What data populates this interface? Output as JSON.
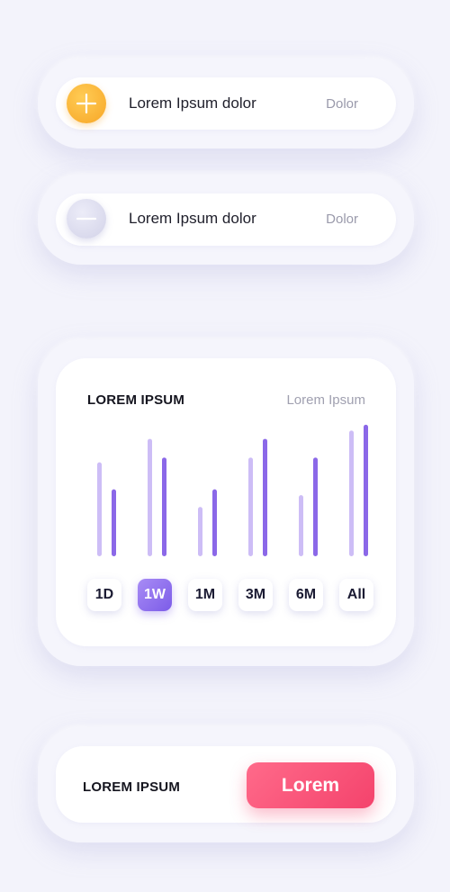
{
  "rows": [
    {
      "icon": "plus-icon",
      "label": "Lorem Ipsum dolor",
      "value": "Dolor",
      "icon_color": "#f7a626"
    },
    {
      "icon": "minus-icon",
      "label": "Lorem Ipsum dolor",
      "value": "Dolor",
      "icon_color": "#d2d2e8"
    }
  ],
  "chart_card": {
    "title": "LOREM IPSUM",
    "subtitle": "Lorem Ipsum",
    "tabs": [
      "1D",
      "1W",
      "1M",
      "3M",
      "6M",
      "All"
    ],
    "active_tab": "1W"
  },
  "chart_data": {
    "type": "bar",
    "categories": [
      "1D",
      "1W",
      "1M",
      "3M",
      "6M",
      "All"
    ],
    "series": [
      {
        "values": [
          80,
          100,
          42,
          84,
          52,
          107
        ],
        "color": "#cdbdf6"
      },
      {
        "values": [
          57,
          84,
          57,
          100,
          84,
          112
        ],
        "color": "#8b68e8"
      }
    ],
    "ylim": [
      0,
      115
    ],
    "grid": false
  },
  "bottom_card": {
    "label": "LOREM IPSUM",
    "button_label": "Lorem",
    "button_color": "#f4436c"
  },
  "colors": {
    "background": "#f3f3fb",
    "accent_purple": "#8b68e8",
    "accent_pink": "#f4436c",
    "accent_orange": "#f7a626"
  }
}
